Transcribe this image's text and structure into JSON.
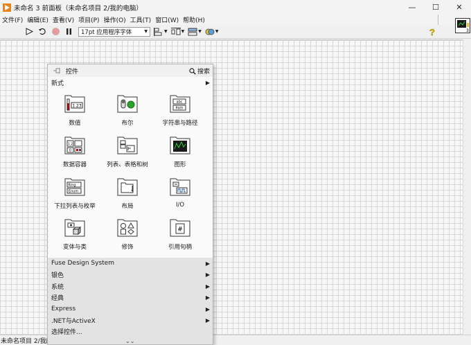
{
  "window": {
    "title": "未命名 3 前面板（未命名项目 2/我的电脑）",
    "minimize": "—",
    "maximize": "☐",
    "close": "✕"
  },
  "menu": [
    "文件(F)",
    "编辑(E)",
    "查看(V)",
    "项目(P)",
    "操作(O)",
    "工具(T)",
    "窗口(W)",
    "帮助(H)"
  ],
  "toolbar": {
    "font_select": "17pt 应用程序字体",
    "vi_icon_number": "3"
  },
  "palette": {
    "title": "控件",
    "search_label": "搜索",
    "new_style_label": "新式",
    "items": [
      {
        "label": "数值",
        "icon": "numeric-icon"
      },
      {
        "label": "布尔",
        "icon": "boolean-icon"
      },
      {
        "label": "字符串与路径",
        "icon": "string-path-icon"
      },
      {
        "label": "数据容器",
        "icon": "array-cluster-icon"
      },
      {
        "label": "列表、表格和树",
        "icon": "list-table-tree-icon"
      },
      {
        "label": "图形",
        "icon": "graph-icon"
      },
      {
        "label": "下拉列表与枚举",
        "icon": "ring-enum-icon"
      },
      {
        "label": "布局",
        "icon": "layout-icon"
      },
      {
        "label": "I/O",
        "icon": "io-icon"
      },
      {
        "label": "变体与类",
        "icon": "variant-class-icon"
      },
      {
        "label": "修饰",
        "icon": "decorations-icon"
      },
      {
        "label": "引用句柄",
        "icon": "refnum-icon"
      }
    ],
    "categories": [
      "Fuse Design System",
      "银色",
      "系统",
      "经典",
      "Express",
      ".NET与ActiveX"
    ],
    "select_control": "选择控件..."
  },
  "status": {
    "text": "未命名项目 2/我的"
  }
}
